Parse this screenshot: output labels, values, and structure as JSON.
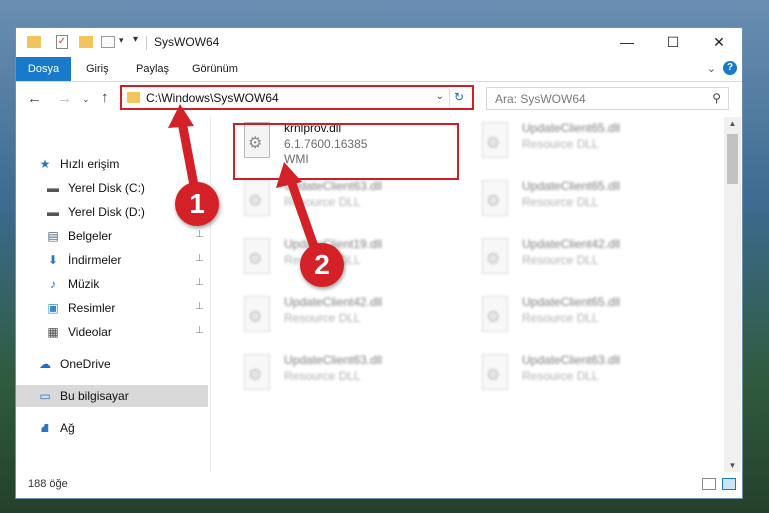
{
  "window": {
    "title": "SysWOW64",
    "min_glyph": "—",
    "max_glyph": "☐",
    "close_glyph": "✕"
  },
  "quick_access_toolbar": {
    "caret": "▾",
    "check_glyph": "✓"
  },
  "ribbon": {
    "tabs": [
      "Dosya",
      "Giriş",
      "Paylaş",
      "Görünüm"
    ],
    "collapse_glyph": "⌄",
    "help_glyph": "?"
  },
  "nav": {
    "back_glyph": "←",
    "forward_glyph": "→",
    "recent_glyph": "⌄",
    "up_glyph": "↑",
    "address": "C:\\Windows\\SysWOW64",
    "address_caret": "⌄",
    "refresh_glyph": "↻",
    "search_placeholder": "Ara: SysWOW64",
    "search_glyph": "⚲"
  },
  "sidebar": {
    "items": [
      {
        "label": "Hızlı erişim",
        "icon": "star-icon",
        "glyph": "★",
        "color": "#2a76c6",
        "pinned": false
      },
      {
        "label": "Yerel Disk (C:)",
        "icon": "drive-icon",
        "glyph": "▬",
        "color": "#555555",
        "pinned": true
      },
      {
        "label": "Yerel Disk (D:)",
        "icon": "drive-icon",
        "glyph": "▬",
        "color": "#555555",
        "pinned": true
      },
      {
        "label": "Belgeler",
        "icon": "documents-icon",
        "glyph": "▤",
        "color": "#4a5f7a",
        "pinned": true
      },
      {
        "label": "İndirmeler",
        "icon": "download-icon",
        "glyph": "⬇",
        "color": "#2a76c6",
        "pinned": true
      },
      {
        "label": "Müzik",
        "icon": "music-icon",
        "glyph": "♪",
        "color": "#2a76c6",
        "pinned": true
      },
      {
        "label": "Resimler",
        "icon": "pictures-icon",
        "glyph": "▣",
        "color": "#3a8acb",
        "pinned": true
      },
      {
        "label": "Videolar",
        "icon": "videos-icon",
        "glyph": "▦",
        "color": "#444444",
        "pinned": true
      },
      {
        "label": "OneDrive",
        "icon": "cloud-icon",
        "glyph": "☁",
        "color": "#1b6fc8",
        "pinned": false
      },
      {
        "label": "Bu bilgisayar",
        "icon": "computer-icon",
        "glyph": "▭",
        "color": "#2a76c6",
        "pinned": false,
        "selected": true
      },
      {
        "label": "Ağ",
        "icon": "network-icon",
        "glyph": "⛘",
        "color": "#2a76c6",
        "pinned": false
      }
    ],
    "pin_glyph": "📌"
  },
  "files": [
    {
      "name": "krnlprov.dll",
      "line2": "6.1.7600.16385",
      "line3": "WMI",
      "highlighted": true,
      "blurred": false
    },
    {
      "name": "UpdateClient65.dll",
      "line2": "Resource DLL",
      "line3": "",
      "blurred": true
    },
    {
      "name": "UpdateClient63.dll",
      "line2": "Resource DLL",
      "line3": "",
      "blurred": true
    },
    {
      "name": "UpdateClient65.dll",
      "line2": "Resource DLL",
      "line3": "",
      "blurred": true
    },
    {
      "name": "UpdateClient19.dll",
      "line2": "Resource DLL",
      "line3": "",
      "blurred": true
    },
    {
      "name": "UpdateClient42.dll",
      "line2": "Resource DLL",
      "line3": "",
      "blurred": true
    },
    {
      "name": "UpdateClient42.dll",
      "line2": "Resource DLL",
      "line3": "",
      "blurred": true
    },
    {
      "name": "UpdateClient65.dll",
      "line2": "Resource DLL",
      "line3": "",
      "blurred": true
    },
    {
      "name": "UpdateClient63.dll",
      "line2": "Resource DLL",
      "line3": "",
      "blurred": true
    },
    {
      "name": "UpdateClient63.dll",
      "line2": "Resource DLL",
      "line3": "",
      "blurred": true
    }
  ],
  "file_icon_glyph": "⚙",
  "scrollbar": {
    "up_glyph": "▲",
    "down_glyph": "▼"
  },
  "status": {
    "count": "188 öğe"
  },
  "annotations": {
    "badge_1": "1",
    "badge_2": "2",
    "color": "#d42027"
  }
}
